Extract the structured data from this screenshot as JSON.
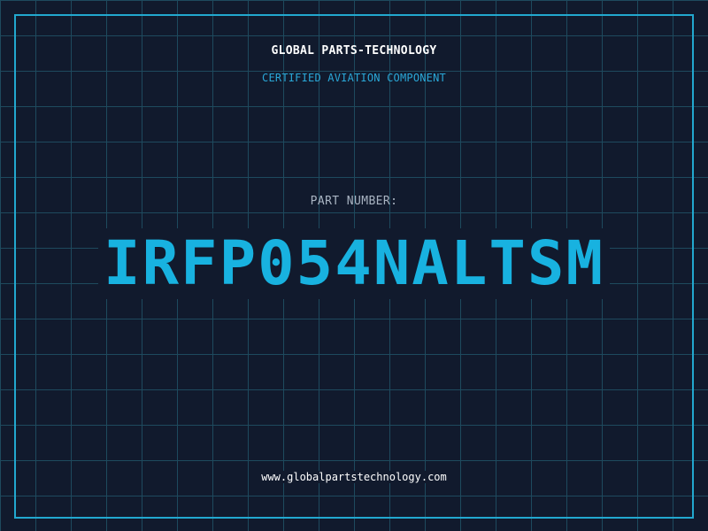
{
  "label": {
    "company": "GLOBAL PARTS-TECHNOLOGY",
    "certification": "CERTIFIED AVIATION COMPONENT",
    "part_number_label": "PART NUMBER:",
    "part_number": "IRFP054NALTSM",
    "website": "www.globalpartstechnology.com"
  },
  "colors": {
    "background": "#111a2d",
    "grid": "#1e4a5e",
    "frame": "#22a8cf",
    "accent": "#18b2e0",
    "muted_text": "#a9b4c2",
    "primary_text": "#ffffff"
  }
}
